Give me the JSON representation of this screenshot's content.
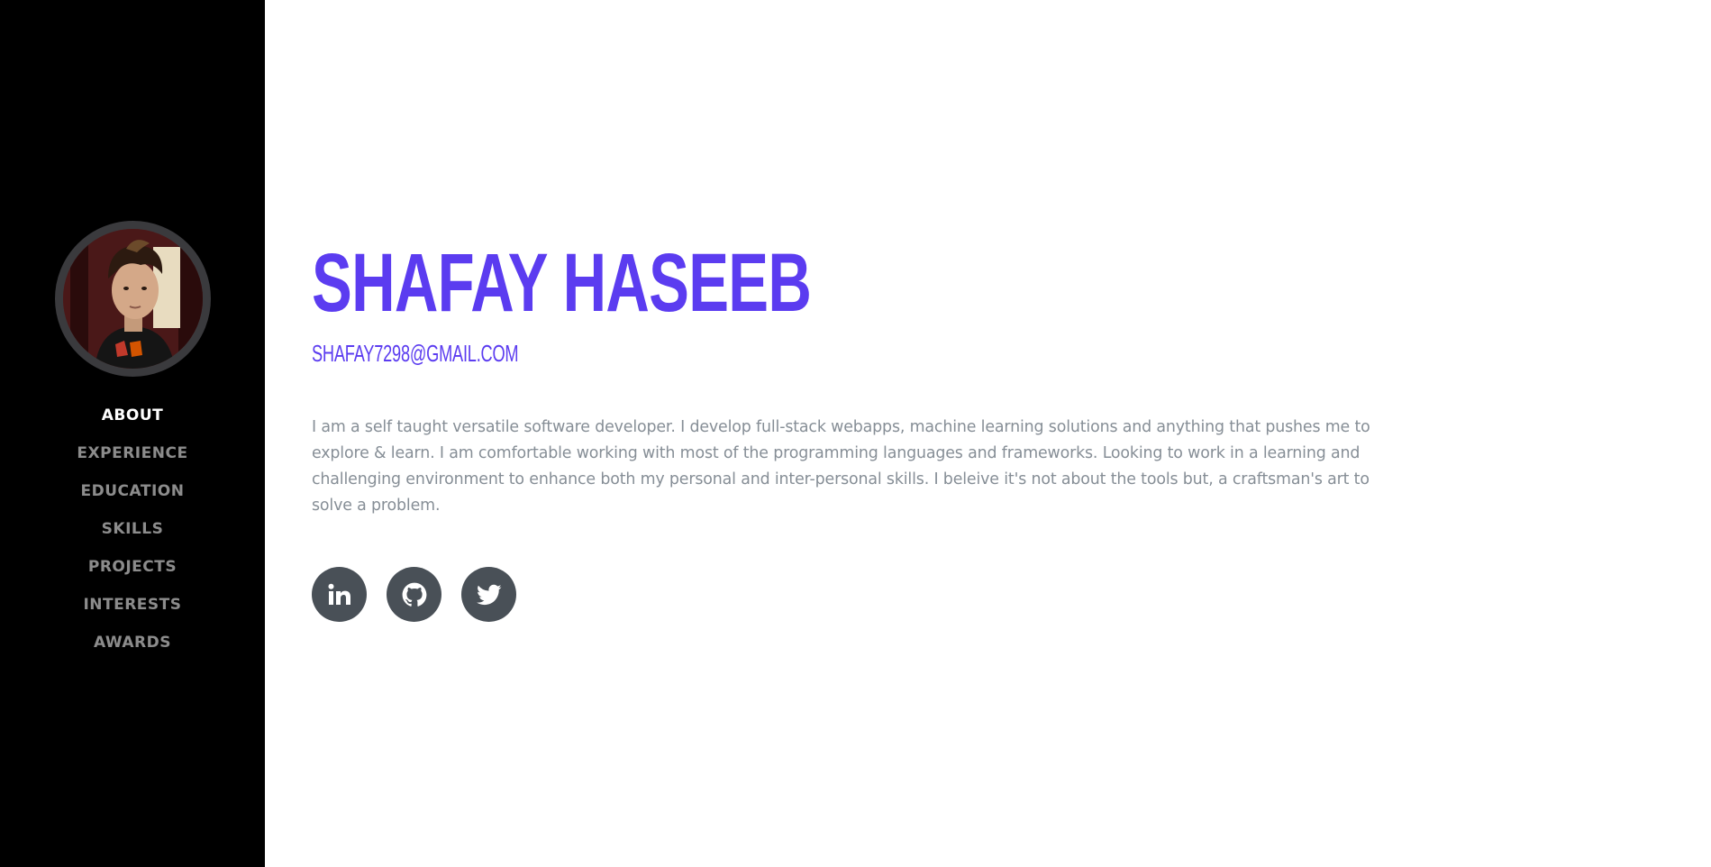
{
  "sidebar": {
    "nav": [
      {
        "label": "ABOUT",
        "active": true
      },
      {
        "label": "EXPERIENCE",
        "active": false
      },
      {
        "label": "EDUCATION",
        "active": false
      },
      {
        "label": "SKILLS",
        "active": false
      },
      {
        "label": "PROJECTS",
        "active": false
      },
      {
        "label": "INTERESTS",
        "active": false
      },
      {
        "label": "AWARDS",
        "active": false
      }
    ]
  },
  "about": {
    "name": "SHAFAY HASEEB",
    "email": "SHAFAY7298@GMAIL.COM",
    "bio": "I am a self taught versatile software developer. I develop full-stack webapps, machine learning solutions and anything that pushes me to explore & learn. I am comfortable working with most of the programming languages and frameworks. Looking to work in a learning and challenging environment to enhance both my personal and inter-personal skills. I beleive it's not about the tools but, a craftsman's art to solve a problem.",
    "socials": [
      {
        "icon": "linkedin-icon"
      },
      {
        "icon": "github-icon"
      },
      {
        "icon": "twitter-icon"
      }
    ]
  },
  "colors": {
    "accent": "#5b3cf0",
    "sidebar_bg": "#000000",
    "text_muted": "#868e96",
    "social_bg": "#495057"
  }
}
